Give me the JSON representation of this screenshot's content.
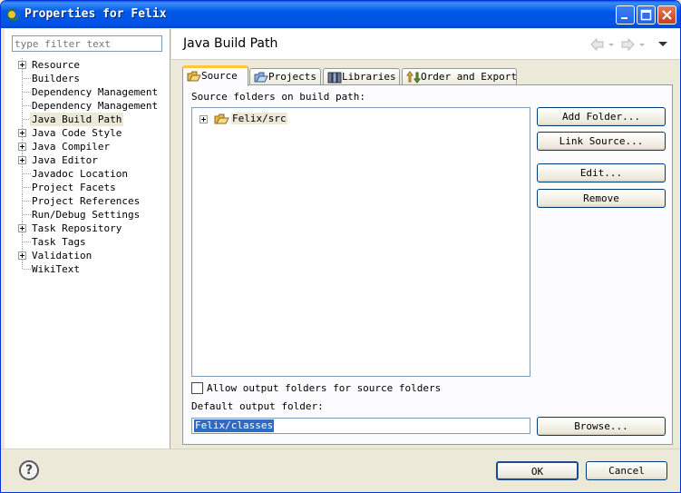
{
  "window": {
    "title": "Properties for Felix"
  },
  "left": {
    "filter_placeholder": "type filter text",
    "tree": [
      {
        "label": "Resource",
        "expandable": true
      },
      {
        "label": "Builders",
        "expandable": false
      },
      {
        "label": "Dependency Management",
        "expandable": false
      },
      {
        "label": "Dependency Management",
        "expandable": false
      },
      {
        "label": "Java Build Path",
        "expandable": false,
        "selected": true
      },
      {
        "label": "Java Code Style",
        "expandable": true
      },
      {
        "label": "Java Compiler",
        "expandable": true
      },
      {
        "label": "Java Editor",
        "expandable": true
      },
      {
        "label": "Javadoc Location",
        "expandable": false
      },
      {
        "label": "Project Facets",
        "expandable": false
      },
      {
        "label": "Project References",
        "expandable": false
      },
      {
        "label": "Run/Debug Settings",
        "expandable": false
      },
      {
        "label": "Task Repository",
        "expandable": true
      },
      {
        "label": "Task Tags",
        "expandable": false
      },
      {
        "label": "Validation",
        "expandable": true
      },
      {
        "label": "WikiText",
        "expandable": false
      }
    ]
  },
  "page": {
    "title": "Java Build Path",
    "tabs": [
      "Source",
      "Projects",
      "Libraries",
      "Order and Export"
    ],
    "source_label": "Source folders on build path:",
    "folders": [
      "Felix/src"
    ],
    "buttons": {
      "add_folder": "Add Folder...",
      "link_source": "Link Source...",
      "edit": "Edit...",
      "remove": "Remove",
      "browse": "Browse..."
    },
    "allow_output_label": "Allow output folders for source folders",
    "allow_output_checked": false,
    "default_output_label": "Default output folder:",
    "default_output_value": "Felix/classes"
  },
  "footer": {
    "ok": "OK",
    "cancel": "Cancel",
    "help_glyph": "?"
  }
}
